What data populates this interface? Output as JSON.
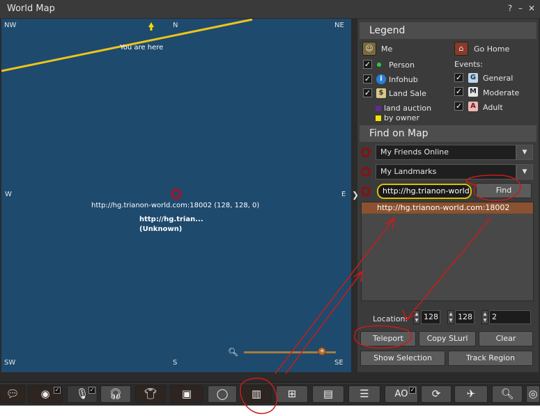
{
  "window": {
    "title": "World Map",
    "help": "?",
    "minimize": "–",
    "close": "✕"
  },
  "map": {
    "compass": {
      "nw": "NW",
      "n": "N",
      "ne": "NE",
      "w": "W",
      "e": "E",
      "sw": "SW",
      "s": "S",
      "se": "SE"
    },
    "you_are_here": "You are here",
    "location_label": "http://hg.trianon-world.com:18002 (128, 128, 0)",
    "region_name": "http://hg.trian...",
    "region_status": "(Unknown)",
    "zoom_level": 0.85
  },
  "legend": {
    "title": "Legend",
    "me": "Me",
    "go_home": "Go Home",
    "person": "Person",
    "infohub": "Infohub",
    "land_sale": "Land Sale",
    "land_auction": "land auction",
    "by_owner": "by owner",
    "events": "Events:",
    "general": "General",
    "moderate": "Moderate",
    "adult": "Adult",
    "icons": {
      "general": "G",
      "moderate": "M",
      "adult": "A"
    },
    "checked": {
      "person": true,
      "infohub": true,
      "land_sale": true,
      "general": true,
      "moderate": true,
      "adult": true
    }
  },
  "find": {
    "title": "Find on Map",
    "friends_combo": "My Friends Online",
    "landmarks_combo": "My Landmarks",
    "search_value": "http://hg.trianon-world.",
    "find_button": "Find",
    "results": [
      "http://hg.trianon-world.com:18002"
    ]
  },
  "location": {
    "label": "Location:",
    "x": "128",
    "y": "128",
    "z": "2"
  },
  "buttons": {
    "teleport": "Teleport",
    "copy_slurl": "Copy SLurl",
    "clear": "Clear",
    "show_selection": "Show Selection",
    "track_region": "Track Region"
  },
  "toolbar": {
    "ao_label": "AO",
    "icons": [
      "speech-icon",
      "chat-icon",
      "microphone-icon",
      "headphones-icon",
      "shirt-icon",
      "inventory-icon",
      "globe-icon",
      "map-icon",
      "minimap-icon",
      "guidebook-icon",
      "notes-icon",
      "ao-icon",
      "refresh-icon",
      "satellite-icon",
      "search-icon",
      "more-icon"
    ]
  },
  "colors": {
    "map_water": "#1e4a6d",
    "annotation": "#cc1b1b",
    "selected_row": "#8a5230",
    "search_border": "#d8c200",
    "location_ring": "#8a1010"
  }
}
